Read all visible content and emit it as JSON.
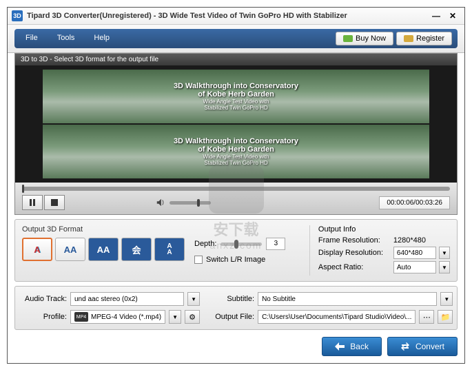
{
  "titlebar": {
    "title": "Tipard 3D Converter(Unregistered)  -  3D Wide Test Video of Twin GoPro HD with Stabilizer"
  },
  "menu": {
    "file": "File",
    "tools": "Tools",
    "help": "Help"
  },
  "promo": {
    "buy": "Buy Now",
    "register": "Register"
  },
  "preview": {
    "header": "3D to 3D - Select 3D format for the output file",
    "overlay_line1": "3D Walkthrough into Conservatory",
    "overlay_line2": "of Kobe Herb Garden",
    "overlay_line3": "Wide Angle Test Video with",
    "overlay_line4": "Stabilized Twin GoPro HD",
    "time": "00:00:06/00:03:26"
  },
  "format": {
    "title": "Output 3D Format",
    "anaglyph": "A",
    "sbs1": "AA",
    "sbs2": "AA",
    "tb1": "会",
    "tb2_a": "A",
    "tb2_b": "A",
    "depth_label": "Depth:",
    "depth_value": "3",
    "switch_label": "Switch L/R Image"
  },
  "output_info": {
    "title": "Output Info",
    "frame_label": "Frame Resolution:",
    "frame_value": "1280*480",
    "display_label": "Display Resolution:",
    "display_value": "640*480",
    "aspect_label": "Aspect Ratio:",
    "aspect_value": "Auto"
  },
  "fields": {
    "audio_label": "Audio Track:",
    "audio_value": "und aac stereo (0x2)",
    "subtitle_label": "Subtitle:",
    "subtitle_value": "No Subtitle",
    "profile_label": "Profile:",
    "profile_value": "MPEG-4 Video (*.mp4)",
    "output_label": "Output File:",
    "output_value": "C:\\Users\\User\\Documents\\Tipard Studio\\Video\\..."
  },
  "buttons": {
    "back": "Back",
    "convert": "Convert"
  },
  "watermark": {
    "line1": "安下载",
    "line2": "anxz.com"
  }
}
